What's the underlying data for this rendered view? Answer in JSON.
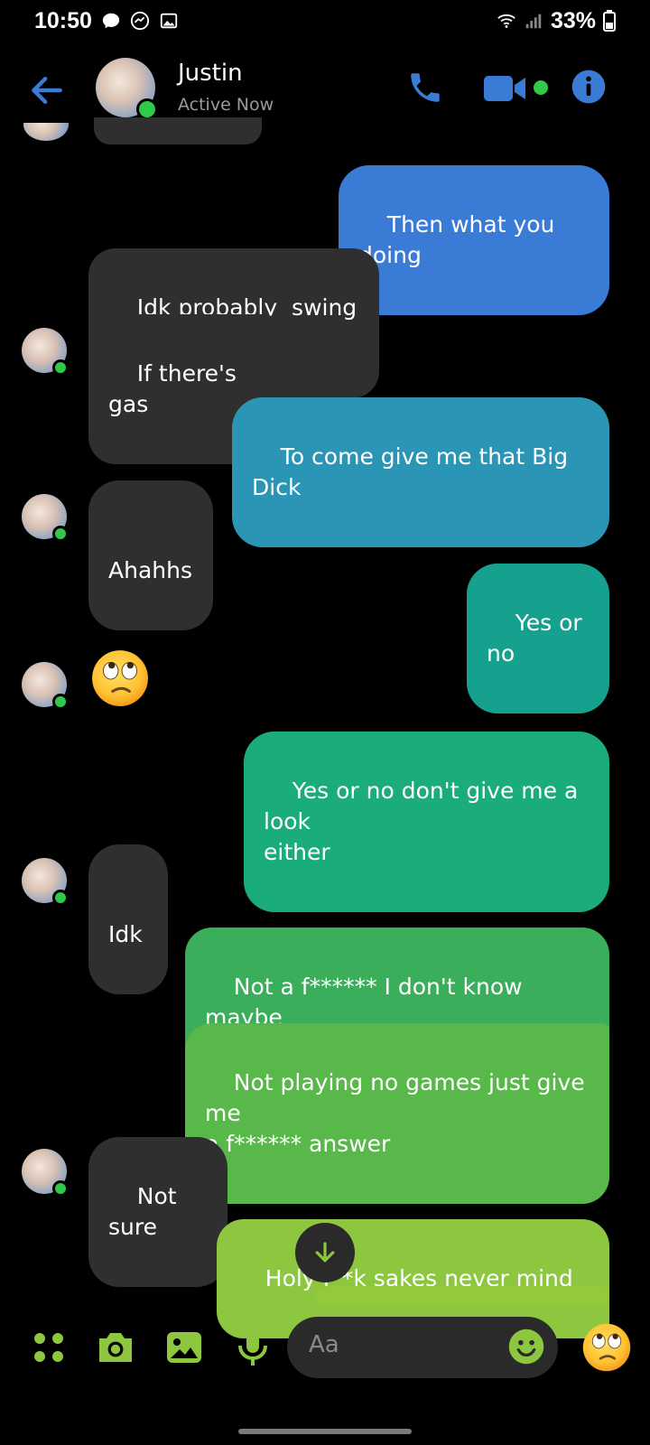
{
  "status_bar": {
    "time": "10:50",
    "battery": "33%"
  },
  "header": {
    "contact_name": "Justin",
    "contact_status": "Active Now"
  },
  "messages": [
    {
      "side": "out",
      "text": "Then what you doing"
    },
    {
      "side": "in",
      "text": "Idk probably  swing by"
    },
    {
      "side": "in",
      "text": "If there's gas"
    },
    {
      "side": "out",
      "text": "To come give me that Big Dick"
    },
    {
      "side": "in",
      "text": "Ahahhs"
    },
    {
      "side": "out",
      "text": "Yes or no"
    },
    {
      "side": "in",
      "text": "🙄",
      "emoji": "eye-roll-emoji"
    },
    {
      "side": "out",
      "text": "Yes or no don't give me a look\neither"
    },
    {
      "side": "in",
      "text": "Idk"
    },
    {
      "side": "out",
      "text": "Not a f****** I don't know maybe\nor look yes or no tell me"
    },
    {
      "side": "out",
      "text": "Not playing no games just give me\na f****** answer"
    },
    {
      "side": "in",
      "text": "Not sure"
    },
    {
      "side": "out",
      "text": "Holy f**k sakes never mind"
    }
  ],
  "composer": {
    "placeholder": "Aa"
  },
  "colors": {
    "accent_blue": "#3a7bd5",
    "incoming_bubble": "#2f2f2f",
    "online_green": "#31c94a",
    "composer_green": "#8dc63f"
  }
}
